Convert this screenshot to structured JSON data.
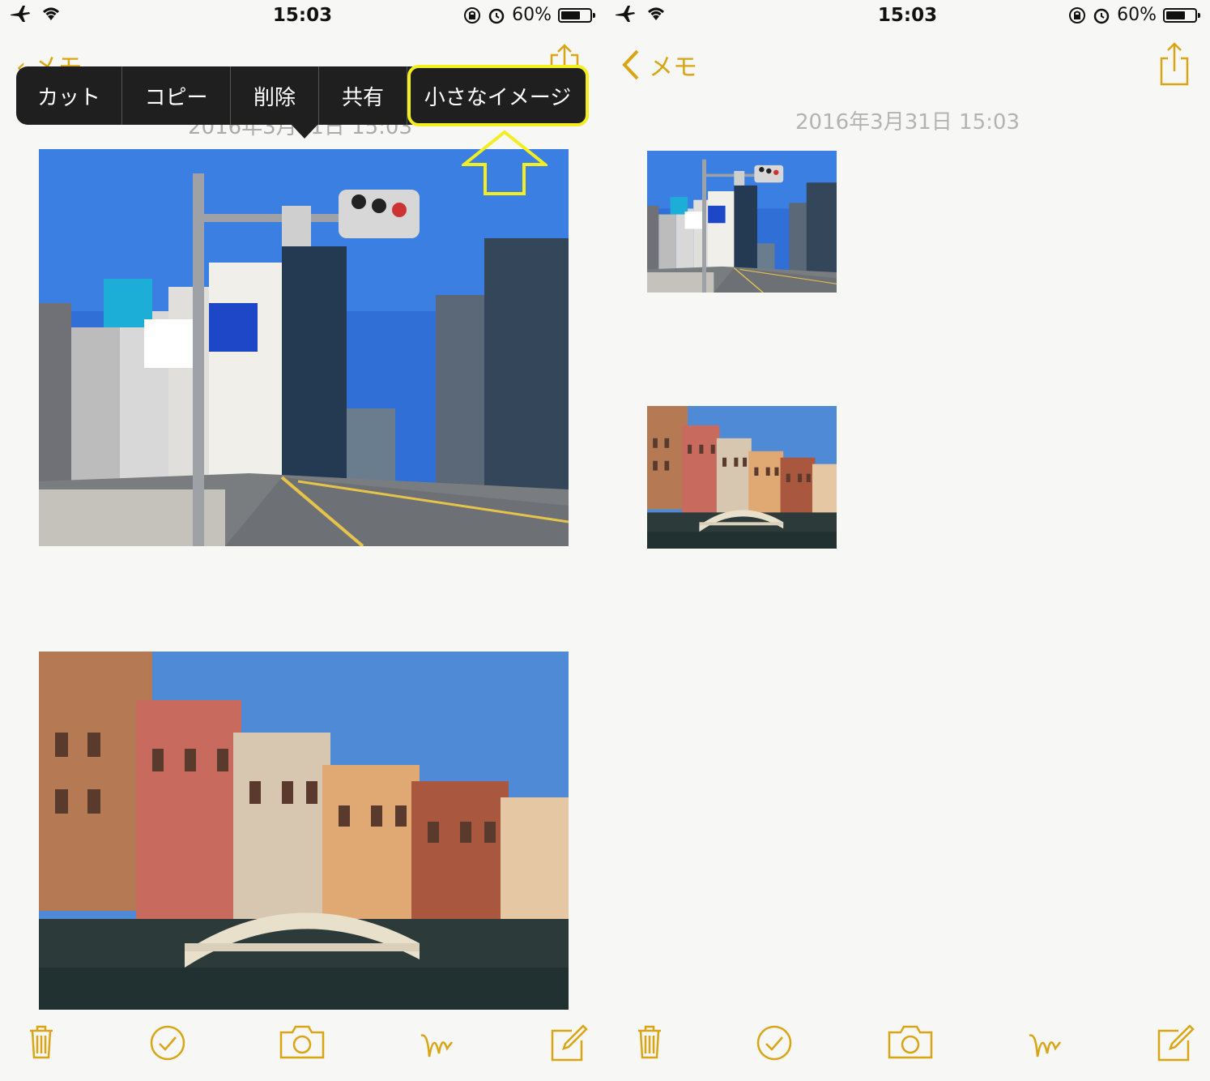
{
  "status": {
    "time": "15:03",
    "battery": "60%",
    "battery_level": 0.6
  },
  "nav": {
    "back_label": "メモ"
  },
  "note": {
    "date": "2016年3月31日 15:03"
  },
  "context_menu": {
    "items": [
      "カット",
      "コピー",
      "削除",
      "共有",
      "小さなイメージ"
    ],
    "highlighted_item": "小さなイメージ"
  },
  "photos": [
    {
      "subject": "city-intersection"
    },
    {
      "subject": "venetian-canal-bridge"
    }
  ],
  "toolbar": {
    "icons": [
      "trash-icon",
      "checklist-icon",
      "camera-icon",
      "sketch-icon",
      "compose-icon"
    ]
  },
  "colors": {
    "accent": "#d9a514",
    "highlight": "#f4ee1f",
    "menu_bg": "#1f1f1f",
    "date_text": "#b3b3b3"
  }
}
